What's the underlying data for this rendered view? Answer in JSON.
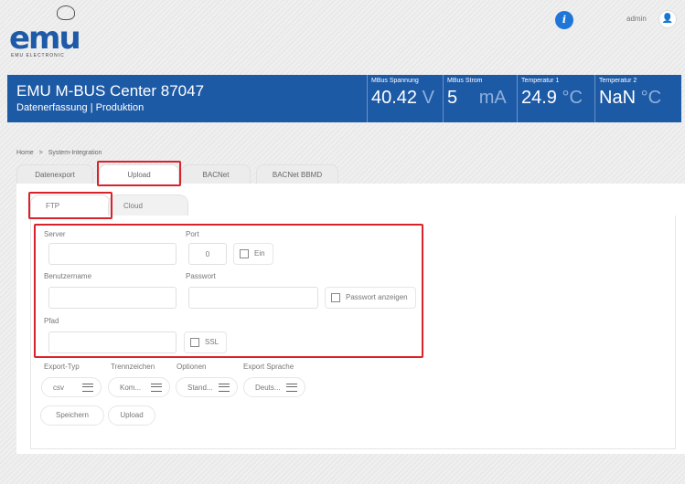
{
  "logo": {
    "word": "emu",
    "sub": "EMU ELECTRONIC"
  },
  "user": {
    "info_label": "i",
    "name": "admin",
    "user_glyph": "👤"
  },
  "header": {
    "title": "EMU M-BUS Center 87047",
    "subtitle": "Datenerfassung | Produktion",
    "metrics": [
      {
        "label": "MBus Spannung",
        "value": "40.42",
        "unit": "V"
      },
      {
        "label": "MBus Strom",
        "value": "5",
        "unit": "mA"
      },
      {
        "label": "Temperatur 1",
        "value": "24.9",
        "unit": "°C"
      },
      {
        "label": "Temperatur 2",
        "value": "NaN",
        "unit": "°C"
      }
    ]
  },
  "breadcrumb": {
    "home": "Home",
    "sep": ">",
    "current": "System-Integration"
  },
  "tabs": [
    "Datenexport",
    "Upload",
    "BACNet",
    "BACNet BBMD"
  ],
  "subtabs": [
    "FTP",
    "Cloud"
  ],
  "form": {
    "server_label": "Server",
    "server_value": "",
    "port_label": "Port",
    "port_value": "0",
    "ein_label": "Ein",
    "username_label": "Benutzername",
    "username_value": "",
    "password_label": "Passwort",
    "password_value": "",
    "show_password_label": "Passwort anzeigen",
    "path_label": "Pfad",
    "path_value": "",
    "ssl_label": "SSL"
  },
  "export": {
    "type_label": "Export-Typ",
    "type_value": "csv",
    "separator_label": "Trennzeichen",
    "separator_value": "Kom...",
    "options_label": "Optionen",
    "options_value": "Stand...",
    "language_label": "Export Sprache",
    "language_value": "Deuts..."
  },
  "buttons": {
    "save": "Speichern",
    "upload": "Upload"
  },
  "colors": {
    "brand": "#1d5aa6",
    "highlight": "#d8232a",
    "info": "#1f76d8"
  }
}
